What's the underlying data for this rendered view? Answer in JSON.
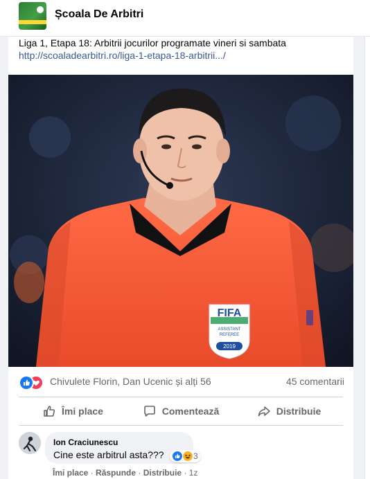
{
  "page": {
    "name": "Școala De Arbitri"
  },
  "post": {
    "text": "Liga 1, Etapa 18: Arbitrii jocurilor programate vineri si sambata",
    "link": "http://scoaladearbitri.ro/liga-1-etapa-18-arbitrii.../",
    "photo_text": {
      "badge_logo": "FIFA",
      "badge_line1": "ASSISTANT",
      "badge_line2": "REFEREE",
      "badge_year": "2019"
    }
  },
  "reactions": {
    "icons": [
      "like-icon",
      "love-icon"
    ],
    "summary": "Chivulete Florin, Dan Ucenic și alți 56",
    "comments": "45 comentarii"
  },
  "actions": {
    "like": "Îmi place",
    "comment": "Comentează",
    "share": "Distribuie"
  },
  "comment": {
    "author": "Ion Craciunescu",
    "text": "Cine este arbitrul asta???",
    "reaction_count": "3",
    "reaction_icons": [
      "like-icon",
      "haha-icon"
    ],
    "like_label": "Îmi place",
    "reply_label": "Răspunde",
    "share_label": "Distribuie",
    "time": "1z",
    "separator": "·"
  },
  "colors": {
    "link": "#385898",
    "like": "#1877f2",
    "love": "#f33e58",
    "shirt": "#f4623a"
  }
}
